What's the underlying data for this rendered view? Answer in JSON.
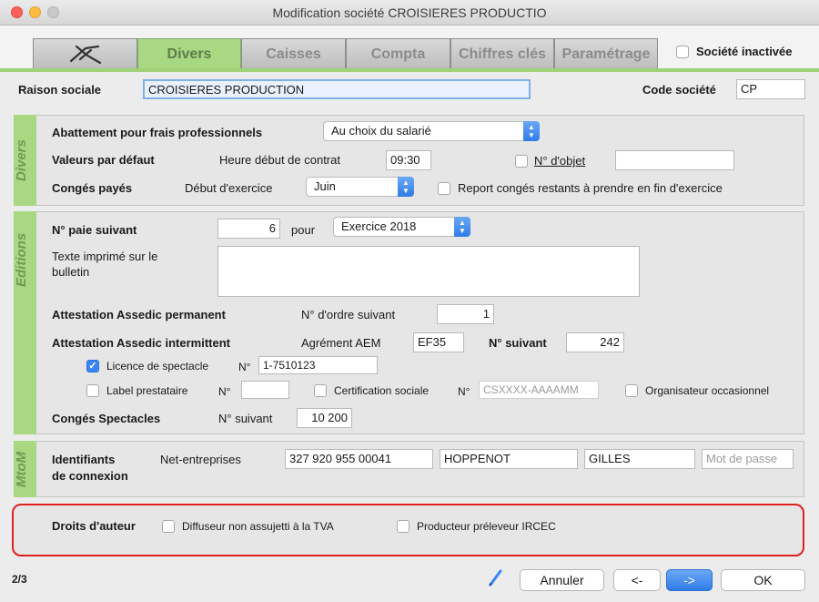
{
  "window": {
    "title": "Modification société CROISIERES PRODUCTIO"
  },
  "tabs": [
    "Divers",
    "Caisses",
    "Compta",
    "Chiffres clés",
    "Paramétrage"
  ],
  "header": {
    "inactive_label": "Société inactivée",
    "raison_label": "Raison sociale",
    "raison_value": "CROISIERES PRODUCTION",
    "code_label": "Code société",
    "code_value": "CP"
  },
  "divers": {
    "side_label": "Divers",
    "abattement_label": "Abattement pour frais professionnels",
    "abattement_value": "Au choix du salarié",
    "valeurs_label": "Valeurs par défaut",
    "heure_label": "Heure début de contrat",
    "heure_value": "09:30",
    "objet_label": "N° d'objet",
    "objet_value": "",
    "conges_label": "Congés payés",
    "debut_label": "Début d'exercice",
    "debut_value": "Juin",
    "report_label": "Report congés restants à prendre en fin d'exercice"
  },
  "editions": {
    "side_label": "Editions",
    "paie_label": "N° paie suivant",
    "paie_value": "6",
    "pour_label": "pour",
    "exercice_value": "Exercice 2018",
    "texte_label_1": "Texte imprimé sur le",
    "texte_label_2": "bulletin",
    "texte_value": "",
    "assedic_perm_label": "Attestation Assedic permanent",
    "ordre_label": "N° d'ordre suivant",
    "ordre_value": "1",
    "assedic_int_label": "Attestation Assedic intermittent",
    "agrement_label": "Agrément AEM",
    "agrement_value": "EF35",
    "suivant_label": "N° suivant",
    "suivant_value": "242",
    "licence_label": "Licence de spectacle",
    "licence_no_label": "N°",
    "licence_value": "1-7510123",
    "label_prest_label": "Label prestataire",
    "label_no_label": "N°",
    "label_value": "",
    "certif_label": "Certification sociale",
    "certif_no_label": "N°",
    "certif_placeholder": "CSXXXX-AAAAMM",
    "organisateur_label": "Organisateur occasionnel",
    "conges_spec_label": "Congés Spectacles",
    "conges_no_label": "N° suivant",
    "conges_value": "10 200"
  },
  "mtom": {
    "side_label": "MtoM",
    "ident_label_1": "Identifiants",
    "ident_label_2": "de connexion",
    "net_label": "Net-entreprises",
    "siret_value": "327 920 955 00041",
    "nom_value": "HOPPENOT",
    "prenom_value": "GILLES",
    "mdp_placeholder": "Mot de passe"
  },
  "droits": {
    "label": "Droits d'auteur",
    "diffuseur_label": "Diffuseur non assujetti à la TVA",
    "producteur_label": "Producteur préleveur IRCEC"
  },
  "footer": {
    "page": "2/3",
    "annuler": "Annuler",
    "prev": "<-",
    "next": "->",
    "ok": "OK"
  },
  "icons": {
    "tab_logo": "scissors-bird-logo-icon",
    "pen": "pen-icon",
    "popup_arrows": "updown-chevron-icon"
  }
}
